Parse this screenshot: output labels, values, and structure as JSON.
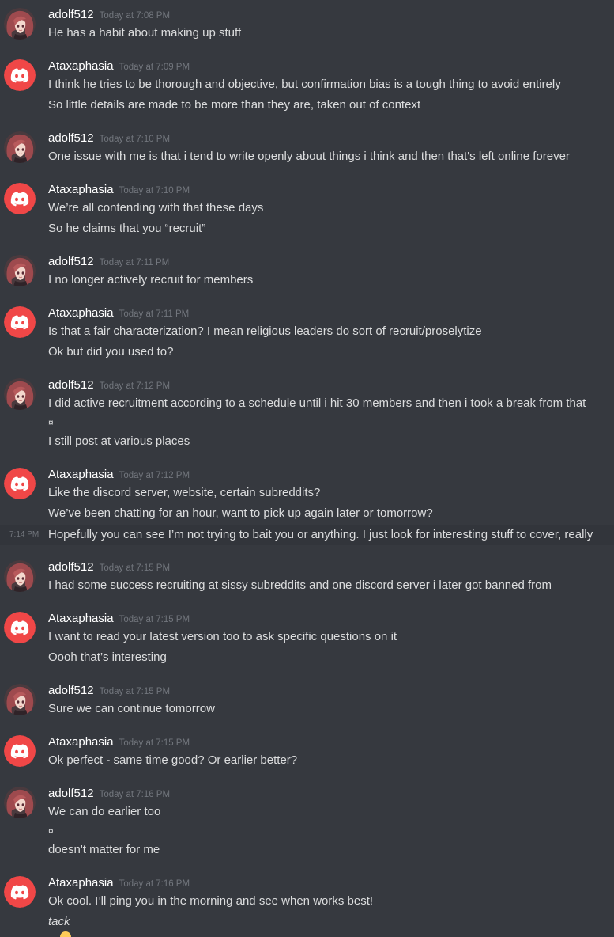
{
  "colors": {
    "background": "#36393f",
    "username": "#ffffff",
    "timestamp": "#72767d",
    "message": "#dcddde",
    "discord_blurple": "#f04747"
  },
  "groups": [
    {
      "user": "adolf512",
      "time": "Today at 7:08 PM",
      "avatar": "anime-girl-avatar",
      "lines": [
        "He has a habit about making up stuff"
      ]
    },
    {
      "user": "Ataxaphasia",
      "time": "Today at 7:09 PM",
      "avatar": "discord-logo-icon",
      "lines": [
        "I think he tries to be thorough and objective, but confirmation bias is a tough thing to avoid entirely",
        "So little details are made to be more than they are, taken out of context"
      ]
    },
    {
      "user": "adolf512",
      "time": "Today at 7:10 PM",
      "avatar": "anime-girl-avatar",
      "lines": [
        "One issue with me is that i tend to write openly about things i think and then that's left online forever"
      ]
    },
    {
      "user": "Ataxaphasia",
      "time": "Today at 7:10 PM",
      "avatar": "discord-logo-icon",
      "lines": [
        "We’re all contending with that these days",
        "So he claims that you “recruit”"
      ]
    },
    {
      "user": "adolf512",
      "time": "Today at 7:11 PM",
      "avatar": "anime-girl-avatar",
      "lines": [
        "I no longer actively recruit for members"
      ]
    },
    {
      "user": "Ataxaphasia",
      "time": "Today at 7:11 PM",
      "avatar": "discord-logo-icon",
      "lines": [
        "Is that a fair characterization? I mean religious leaders do sort of recruit/proselytize",
        "Ok but did you used to?"
      ]
    },
    {
      "user": "adolf512",
      "time": "Today at 7:12 PM",
      "avatar": "anime-girl-avatar",
      "lines": [
        "I did active recruitment according to a schedule until i hit 30 members and then i took a break from that",
        "¤",
        "I still post at various places"
      ]
    },
    {
      "user": "Ataxaphasia",
      "time": "Today at 7:12 PM",
      "avatar": "discord-logo-icon",
      "lines": [
        "Like the discord server, website, certain subreddits?",
        "We’ve been chatting for an hour, want to pick up again later or tomorrow?"
      ]
    },
    {
      "user": "adolf512",
      "time": "Today at 7:15 PM",
      "avatar": "anime-girl-avatar",
      "lines": [
        "I had some success recruiting at sissy subreddits and one discord server i later got banned from"
      ]
    },
    {
      "user": "Ataxaphasia",
      "time": "Today at 7:15 PM",
      "avatar": "discord-logo-icon",
      "lines": [
        "I want to read your latest version too to ask specific questions on it",
        "Oooh that’s interesting"
      ]
    },
    {
      "user": "adolf512",
      "time": "Today at 7:15 PM",
      "avatar": "anime-girl-avatar",
      "lines": [
        "Sure we can continue tomorrow"
      ]
    },
    {
      "user": "Ataxaphasia",
      "time": "Today at 7:15 PM",
      "avatar": "discord-logo-icon",
      "lines": [
        "Ok perfect - same time good? Or earlier better?"
      ]
    },
    {
      "user": "adolf512",
      "time": "Today at 7:16 PM",
      "avatar": "anime-girl-avatar",
      "lines": [
        "We can do earlier too",
        "¤",
        "doesn't matter for me"
      ]
    },
    {
      "user": "Ataxaphasia",
      "time": "Today at 7:16 PM",
      "avatar": "discord-logo-icon",
      "lines": [
        "Ok cool. I’ll ping you in the morning and see when works best!",
        "tack"
      ]
    }
  ],
  "hover_message": {
    "time": "7:14 PM",
    "text": "Hopefully you can see I’m not trying to bait you or anything. I just look for interesting stuff to cover, really"
  },
  "partial_emoji": "yellow-heart-emoji"
}
